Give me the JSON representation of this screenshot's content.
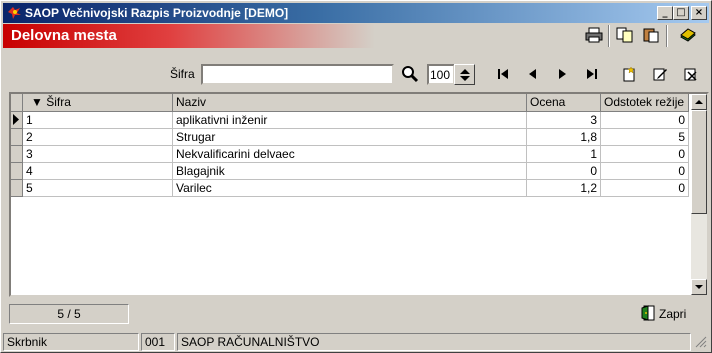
{
  "window": {
    "title": "SAOP Večnivojski Razpis Proizvodnje [DEMO]",
    "minimize": "_",
    "maximize": "□",
    "close": "×"
  },
  "form": {
    "title": "Delovna mesta"
  },
  "search": {
    "label": "Šifra",
    "value": "",
    "limit": "100"
  },
  "grid": {
    "columns": [
      "▼ Šifra",
      "Naziv",
      "Ocena",
      "Odstotek režije"
    ],
    "rows": [
      {
        "sifra": "1",
        "naziv": "aplikativni inženir",
        "ocena": "3",
        "odstotek": "0"
      },
      {
        "sifra": "2",
        "naziv": "Strugar",
        "ocena": "1,8",
        "odstotek": "5"
      },
      {
        "sifra": "3",
        "naziv": "Nekvalificarini delvaec",
        "ocena": "1",
        "odstotek": "0"
      },
      {
        "sifra": "4",
        "naziv": "Blagajnik",
        "ocena": "0",
        "odstotek": "0"
      },
      {
        "sifra": "5",
        "naziv": "Varilec",
        "ocena": "1,2",
        "odstotek": "0"
      }
    ]
  },
  "footer": {
    "counter": "5 / 5",
    "close_label": "Zapri"
  },
  "status": {
    "user": "Skrbnik",
    "code": "001",
    "company": "SAOP RAČUNALNIŠTVO"
  },
  "colors": {
    "titlebar": "#0a246a",
    "form_title": "#c80000"
  }
}
